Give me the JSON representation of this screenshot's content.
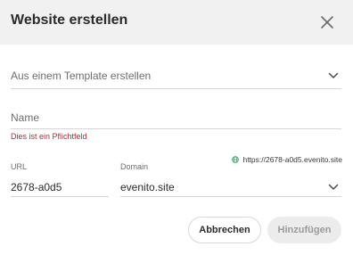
{
  "dialog": {
    "title": "Website erstellen",
    "close_icon": "close-icon"
  },
  "template_select": {
    "label": "Aus einem Template erstellen",
    "icon": "chevron-down-icon"
  },
  "name_field": {
    "placeholder": "Name",
    "value": "",
    "error": "Dies ist ein Pflichtfeld"
  },
  "preview_url": {
    "icon": "globe-icon",
    "icon_color": "#2e9e5b",
    "text": "https://2678-a0d5.evenito.site"
  },
  "url_field": {
    "label": "URL",
    "value": "2678-a0d5"
  },
  "domain_field": {
    "label": "Domain",
    "value": "evenito.site",
    "icon": "chevron-down-icon"
  },
  "buttons": {
    "cancel_label": "Abbrechen",
    "add_label": "Hinzufügen"
  },
  "colors": {
    "error": "#c0262d",
    "header_bg": "#f1f1f1",
    "disabled_button_bg": "#ececec"
  }
}
